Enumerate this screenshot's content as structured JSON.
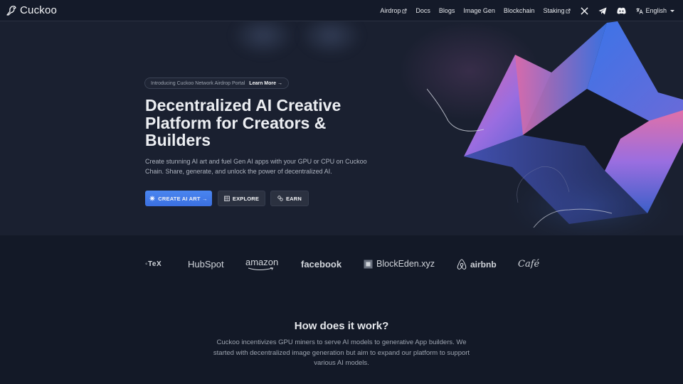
{
  "nav": {
    "logo_text": "Cuckoo",
    "links": [
      {
        "label": "Airdrop",
        "external": true
      },
      {
        "label": "Docs",
        "external": false
      },
      {
        "label": "Blogs",
        "external": false
      },
      {
        "label": "Image Gen",
        "external": false
      },
      {
        "label": "Blockchain",
        "external": false
      },
      {
        "label": "Staking",
        "external": true
      }
    ],
    "social_icons": [
      "x-icon",
      "telegram-icon",
      "discord-icon"
    ],
    "language": "English"
  },
  "hero": {
    "badge_text": "Introducing Cuckoo Network Airdrop Portal",
    "badge_link": "Learn More →",
    "title": "Decentralized AI Creative Platform for Creators & Builders",
    "subtitle": "Create stunning AI art and fuel Gen AI apps with your GPU or CPU on Cuckoo Chain. Share, generate, and unlock the power of decentralized AI.",
    "buttons": {
      "create": "CREATE AI ART →",
      "explore": "EXPLORE",
      "earn": "EARN"
    }
  },
  "partners": [
    "◦TeX",
    "HubSpot",
    "amazon",
    "facebook",
    "BlockEden.xyz",
    "airbnb",
    "Café"
  ],
  "how": {
    "title": "How does it work?",
    "text": "Cuckoo incentivizes GPU miners to serve AI models to generative App builders. We started with decentralized image generation but aim to expand our platform to support various AI models."
  },
  "colors": {
    "background": "#131927",
    "hero_background": "#1a2030",
    "primary_button": "#3b6fe0",
    "secondary_button": "#2b3140"
  }
}
